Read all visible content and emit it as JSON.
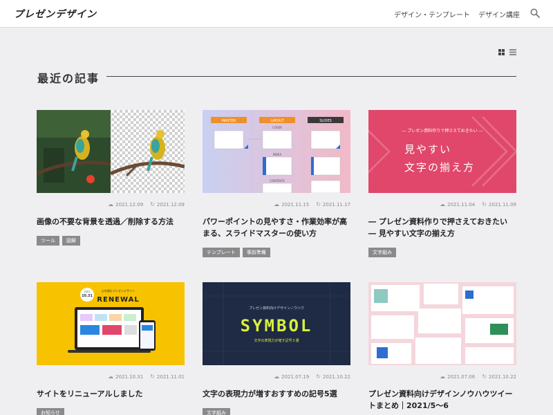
{
  "header": {
    "logo": "プレゼンデザイン",
    "nav": [
      "デザイン・テンプレート",
      "デザイン講座"
    ]
  },
  "section": {
    "title": "最近の記事"
  },
  "thumbnail_text": {
    "c3_banner": "― プレゼン資料作りで押さえておきたい ―",
    "c3_line1": "見やすい",
    "c3_line2": "文字の揃え方",
    "c2_master": "MASTER",
    "c2_layout": "LAYOUT",
    "c2_slides": "SLIDES",
    "c2_cover": "COVER",
    "c2_index": "INDEX",
    "c2_contents": "CONTENTS",
    "c4_date_top": "2021",
    "c4_date": "10.31",
    "c4_caption": "心を掴むプレゼンデザイン",
    "c4_renewal": "RENEWAL",
    "c5_banner": "プレゼン資料向けデザインノウハウ",
    "c5_symbol": "SYMBOL",
    "c5_caption": "文字の表現力が増す記号５選"
  },
  "cards": [
    {
      "published": "2021.12.09",
      "updated": "2021.12.09",
      "title": "画像の不要な背景を透過／削除する方法",
      "tags": [
        "ツール",
        "図解"
      ]
    },
    {
      "published": "2021.11.15",
      "updated": "2021.11.17",
      "title": "パワーポイントの見やすさ・作業効率が高まる、スライドマスターの使い方",
      "tags": [
        "テンプレート",
        "事前準備"
      ]
    },
    {
      "published": "2021.11.04",
      "updated": "2021.11.09",
      "title": "― プレゼン資料作りで押さえておきたい ― 見やすい文字の揃え方",
      "tags": [
        "文字組み"
      ]
    },
    {
      "published": "2021.10.31",
      "updated": "2021.11.01",
      "title": "サイトをリニューアルしました",
      "tags": [
        "お知らせ"
      ]
    },
    {
      "published": "2021.07.19",
      "updated": "2021.10.22",
      "title": "文字の表現力が増すおすすめの記号5選",
      "tags": [
        "文字組み"
      ]
    },
    {
      "published": "2021.07.06",
      "updated": "2021.10.22",
      "title": "プレゼン資料向けデザインノウハウツイートまとめ｜2021/5〜6",
      "tags": []
    }
  ],
  "colors": {
    "accent_pink": "#e0476a",
    "navy": "#1f2a44",
    "yellow": "#f7c200",
    "lime": "#d8f03a"
  },
  "icons": {
    "published": "cloud-upload-icon",
    "updated": "refresh-icon",
    "search": "search-icon"
  }
}
